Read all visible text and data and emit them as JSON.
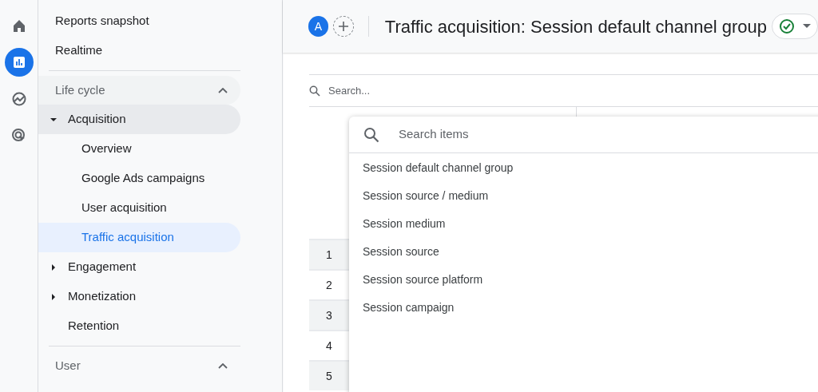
{
  "rail": [
    {
      "kind": "home",
      "selected": false
    },
    {
      "kind": "reports",
      "selected": true
    },
    {
      "kind": "explore",
      "selected": false
    },
    {
      "kind": "advertising",
      "selected": false
    }
  ],
  "sidebar": {
    "top_items": [
      {
        "label": "Reports snapshot"
      },
      {
        "label": "Realtime"
      }
    ],
    "groups": [
      {
        "label": "Life cycle",
        "expanded": true,
        "children": [
          {
            "label": "Acquisition",
            "expanded": true,
            "selected": false,
            "children": [
              {
                "label": "Overview",
                "selected": false
              },
              {
                "label": "Google Ads campaigns",
                "selected": false
              },
              {
                "label": "User acquisition",
                "selected": false
              },
              {
                "label": "Traffic acquisition",
                "selected": true
              }
            ]
          },
          {
            "label": "Engagement",
            "expanded": false,
            "selected": false
          },
          {
            "label": "Monetization",
            "expanded": false,
            "selected": false
          },
          {
            "label": "Retention",
            "selected": false
          }
        ]
      },
      {
        "label": "User",
        "expanded": true
      }
    ]
  },
  "header": {
    "avatar": "A",
    "title": "Traffic acquisition: Session default channel group"
  },
  "table": {
    "search": {
      "placeholder": "Search..."
    },
    "row_numbers": [
      "1",
      "2",
      "3",
      "4",
      "5"
    ]
  },
  "dropdown": {
    "search": {
      "placeholder": "Search items"
    },
    "items": [
      {
        "label": "Session default channel group"
      },
      {
        "label": "Session source / medium"
      },
      {
        "label": "Session medium"
      },
      {
        "label": "Session source"
      },
      {
        "label": "Session source platform"
      },
      {
        "label": "Session campaign"
      }
    ]
  }
}
